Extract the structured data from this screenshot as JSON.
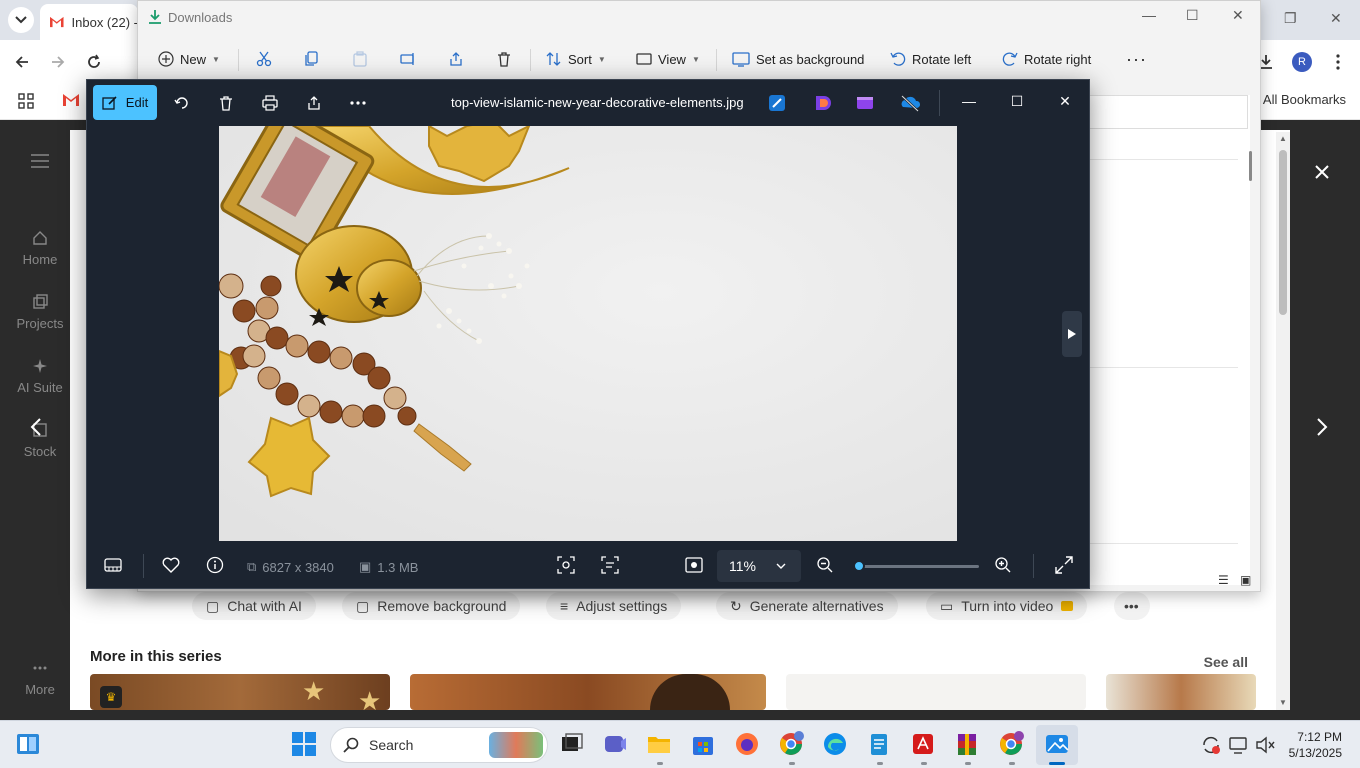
{
  "chrome": {
    "tab_title": "Inbox (22) -",
    "bookmarks_label": "All Bookmarks"
  },
  "freepik": {
    "sidebar": [
      {
        "label": "Home",
        "icon": "home-icon"
      },
      {
        "label": "Projects",
        "icon": "projects-icon"
      },
      {
        "label": "AI Suite",
        "icon": "sparkle-icon"
      },
      {
        "label": "Stock",
        "icon": "stock-icon"
      },
      {
        "label": "More",
        "icon": "more-icon"
      }
    ],
    "actions": [
      "Chat with AI",
      "Remove background",
      "Adjust settings",
      "Generate alternatives",
      "Turn into video"
    ],
    "series_title": "More in this series",
    "see_all": "See all"
  },
  "explorer": {
    "title": "Downloads",
    "toolbar": {
      "new": "New",
      "sort": "Sort",
      "view": "View",
      "set_background": "Set as background",
      "rotate_left": "Rotate left",
      "rotate_right": "Rotate right"
    }
  },
  "photos": {
    "edit_label": "Edit",
    "filename": "top-view-islamic-new-year-decorative-elements.jpg",
    "dimensions": "6827 x 3840",
    "file_size": "1.3 MB",
    "zoom": "11%",
    "zoom_slider_fraction": 0.0
  },
  "taskbar": {
    "search_placeholder": "Search",
    "time": "7:12 PM",
    "date": "5/13/2025"
  },
  "colors": {
    "accent": "#4cc2ff",
    "photos_bg": "#1c2430",
    "freepik_bg": "#2b2b2b",
    "taskbar_bg": "#e8ecf2"
  }
}
